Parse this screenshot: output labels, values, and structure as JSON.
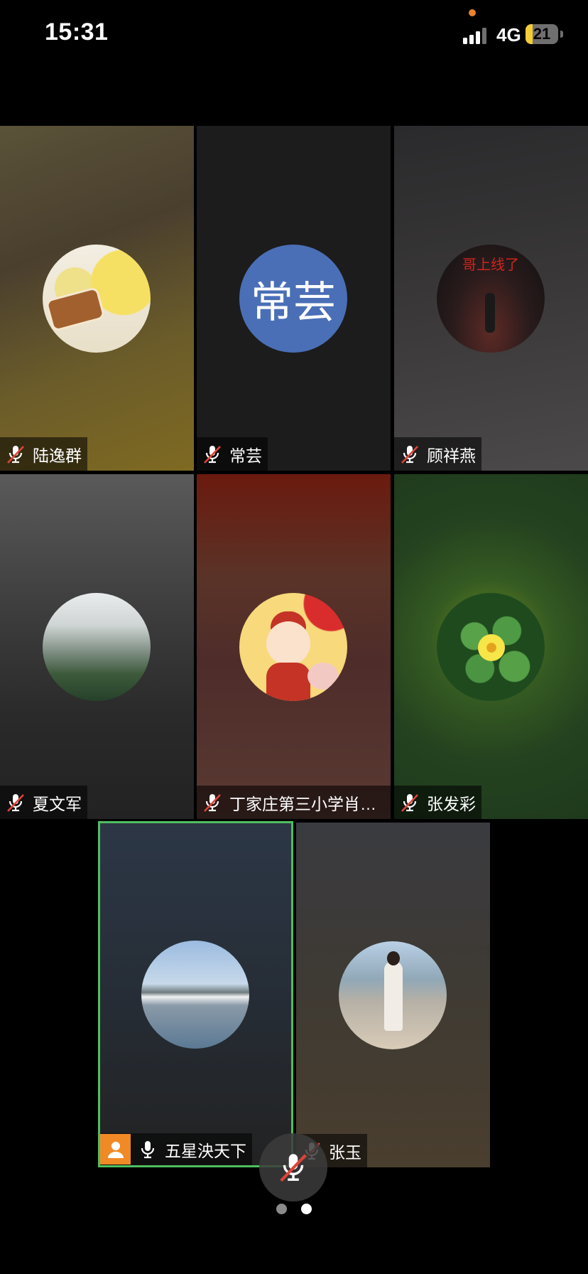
{
  "status_bar": {
    "time": "15:31",
    "network": "4G",
    "battery_level": "21",
    "battery_fraction": 0.21,
    "battery_color": "#f4cd37",
    "signal_bars": 3
  },
  "participants": [
    {
      "name": "陆逸群",
      "muted": true,
      "avatar": "photo-cartoon-chick-bread"
    },
    {
      "name": "常芸",
      "muted": true,
      "avatar_text": "常芸",
      "avatar_color": "#4a6fb7"
    },
    {
      "name": "顾祥燕",
      "muted": true,
      "avatar": "photo-night-poster",
      "avatar_text": "哥上线了"
    },
    {
      "name": "夏文军",
      "muted": true,
      "avatar": "photo-misty-mountains"
    },
    {
      "name": "丁家庄第三小学肖…",
      "muted": true,
      "avatar": "photo-cartoon-boy-pig"
    },
    {
      "name": "张发彩",
      "muted": true,
      "avatar": "photo-clover-flower"
    },
    {
      "name": "五星泱天下",
      "muted": false,
      "is_host": true,
      "active_speaker": true,
      "avatar": "photo-lake-village"
    },
    {
      "name": "张玉",
      "muted": true,
      "avatar": "photo-girl-seaside"
    }
  ],
  "controls": {
    "float_mic_icon": "mic-muted-icon"
  },
  "pagination": {
    "total": 2,
    "current": 2
  },
  "colors": {
    "active_border": "#4fbf5f",
    "host_badge": "#f08a27",
    "mute_slash": "#e0433a"
  }
}
